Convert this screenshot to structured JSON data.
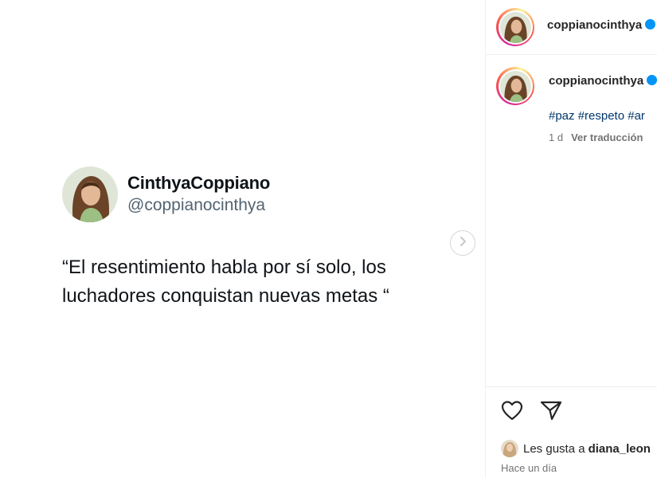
{
  "post": {
    "tweet": {
      "display_name": "CinthyaCoppiano",
      "handle": "@coppianocinthya",
      "text": "“El resentimiento habla por sí solo, los luchadores conquistan nuevas metas “"
    },
    "next_icon": "chevron-right-icon"
  },
  "sidebar": {
    "header_username": "coppianocinthya",
    "caption": {
      "username": "coppianocinthya",
      "hashtags": "#paz #respeto #ar",
      "age": "1 d",
      "translate_label": "Ver traducción"
    },
    "actions": {
      "like_icon": "heart-icon",
      "share_icon": "send-icon"
    },
    "likes": {
      "prefix": "Les gusta a",
      "user": "diana_leon"
    },
    "timestamp": "Hace un día"
  },
  "colors": {
    "verified": "#0095f6",
    "hashtag": "#00376b",
    "secondary_text": "#737373",
    "tweet_handle": "#536471"
  }
}
